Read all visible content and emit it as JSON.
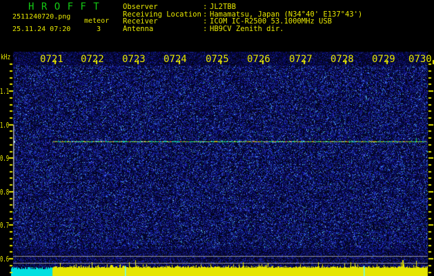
{
  "app": {
    "title": "H R O F F T",
    "title_color": "#14cc14"
  },
  "session": {
    "filename": "2511240720.png",
    "mode": "meteor",
    "datetime": "25.11.24 07:20",
    "count": "3"
  },
  "station": {
    "separator": ":",
    "rows": [
      {
        "label": "Observer",
        "value": "JL2TBB"
      },
      {
        "label": "Receiving Location",
        "value": "Hamamatsu, Japan (N34°40' E137°43')"
      },
      {
        "label": "Receiver",
        "value": "ICOM IC-R2500 53.1000MHz USB"
      },
      {
        "label": "Antenna",
        "value": "HB9CV Zenith dir."
      }
    ]
  },
  "chart_data": {
    "type": "heatmap",
    "subtype": "radio-meteor-spectrogram",
    "title": "",
    "ylabel": "kHz",
    "y_tick_labels": [
      "1.1",
      "1.0",
      "0.9",
      "0.8",
      "0.7",
      "0.6"
    ],
    "y_tick_values_khz": [
      1.1,
      1.0,
      0.9,
      0.8,
      0.7,
      0.6
    ],
    "y_range_khz": [
      0.55,
      1.22
    ],
    "y_minor_tick_step_khz": 0.02,
    "x_tick_labels": [
      "0721",
      "0722",
      "0723",
      "0724",
      "0725",
      "0726",
      "0727",
      "0728",
      "0729",
      "0730"
    ],
    "x_range": [
      "0720",
      "0730"
    ],
    "x_span_minutes": 10,
    "grid": false,
    "carrier_line": {
      "freq_khz": 0.95,
      "start_minute_after_0720": 1,
      "end_minute_after_0720": 10,
      "palette": [
        "#00e6e6",
        "#28dc3c",
        "#96e628",
        "#ebeb00",
        "#f09620",
        "#f03c28",
        "#f0f0f0"
      ]
    },
    "reference_level_lines_khz": [
      0.608,
      0.588
    ],
    "reference_line_color": "#9a9a9a",
    "left_edge_marker": {
      "from_khz": 1.0,
      "to_khz": 0.75,
      "color": "#b4b4bc"
    },
    "signal_level_bar": {
      "segments": [
        {
          "color": "#00e0e0",
          "from_minute": 0,
          "to_minute": 1
        },
        {
          "color": "#e6e600",
          "from_minute": 1,
          "to_minute": 10
        }
      ],
      "event_markers_minutes_after_0720": [
        2.7,
        8.45
      ],
      "event_marker_color": "#66ffff"
    },
    "noise_background": {
      "base": "#000014",
      "speckle": [
        "#000050",
        "#101ea0",
        "#2a46d2",
        "#5a78f0",
        "#96c8ff"
      ]
    }
  },
  "colors": {
    "background": "#000000",
    "text_yellow": "#e8e800",
    "title_green": "#14cc14",
    "axis_gray": "#9a9a9a"
  }
}
